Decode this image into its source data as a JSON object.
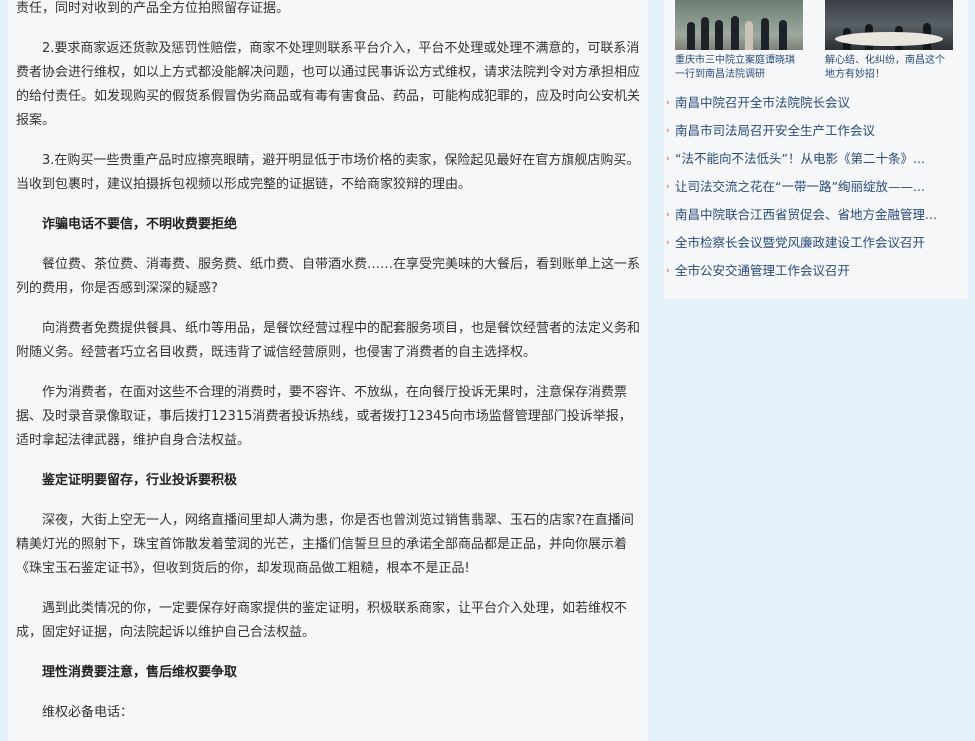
{
  "article": {
    "paragraphs": [
      {
        "kind": "text",
        "text": "责任，同时对收到的产品全方位拍照留存证据。"
      },
      {
        "kind": "text",
        "text": "2.要求商家返还货款及惩罚性赔偿，商家不处理则联系平台介入，平台不处理或处理不满意的，可联系消费者协会进行维权，如以上方式都没能解决问题，也可以通过民事诉讼方式维权，请求法院判令对方承担相应的给付责任。如发现购买的假货系假冒伪劣商品或有毒有害食品、药品，可能构成犯罪的，应及时向公安机关报案。"
      },
      {
        "kind": "text",
        "text": "3.在购买一些贵重产品时应擦亮眼睛，避开明显低于市场价格的卖家，保险起见最好在官方旗舰店购买。当收到包裹时，建议拍摄拆包视频以形成完整的证据链，不给商家狡辩的理由。"
      },
      {
        "kind": "heading",
        "text": "诈骗电话不要信，不明收费要拒绝"
      },
      {
        "kind": "text",
        "text": "餐位费、茶位费、消毒费、服务费、纸巾费、自带酒水费……在享受完美味的大餐后，看到账单上这一系列的费用，你是否感到深深的疑惑?"
      },
      {
        "kind": "text",
        "text": "向消费者免费提供餐具、纸巾等用品，是餐饮经营过程中的配套服务项目，也是餐饮经营者的法定义务和附随义务。经营者巧立名目收费，既违背了诚信经营原则，也侵害了消费者的自主选择权。"
      },
      {
        "kind": "text",
        "text": "作为消费者，在面对这些不合理的消费时，要不容许、不放纵，在向餐厅投诉无果时，注意保存消费票据、及时录音录像取证，事后拨打12315消费者投诉热线，或者拨打12345向市场监督管理部门投诉举报，适时拿起法律武器，维护自身合法权益。"
      },
      {
        "kind": "heading",
        "text": "鉴定证明要留存，行业投诉要积极"
      },
      {
        "kind": "text",
        "text": "深夜，大街上空无一人，网络直播间里却人满为患，你是否也曾浏览过销售翡翠、玉石的店家?在直播间精美灯光的照射下，珠宝首饰散发着莹润的光芒，主播们信誓旦旦的承诺全部商品都是正品，并向你展示着《珠宝玉石鉴定证书》，但收到货后的你，却发现商品做工粗糙，根本不是正品!"
      },
      {
        "kind": "text",
        "text": "遇到此类情况的你，一定要保存好商家提供的鉴定证明，积极联系商家，让平台介入处理，如若维权不成，固定好证据，向法院起诉以维护自己合法权益。"
      },
      {
        "kind": "heading",
        "text": "理性消费要注意，售后维权要争取"
      },
      {
        "kind": "text",
        "text": "维权必备电话："
      }
    ]
  },
  "sidebar": {
    "photos": [
      {
        "caption": "重庆市三中院立案庭谭晓琪一行到南昌法院调研"
      },
      {
        "caption": "解心结、化纠纷，南昌这个地方有妙招！"
      }
    ],
    "news": [
      {
        "title": "南昌中院召开全市法院院长会议"
      },
      {
        "title": "南昌市司法局召开安全生产工作会议"
      },
      {
        "title": "“法不能向不法低头”！从电影《第二十条》..."
      },
      {
        "title": "让司法交流之花在“一带一路”绚丽绽放——..."
      },
      {
        "title": "南昌中院联合江西省贸促会、省地方金融管理..."
      },
      {
        "title": "全市检察长会议暨党风廉政建设工作会议召开"
      },
      {
        "title": "全市公安交通管理工作会议召开"
      }
    ]
  },
  "colors": {
    "page_background": "#e3f3f9",
    "panel_background": "#f5f7f8",
    "body_text": "#333333",
    "link_text": "#2a4a7a",
    "bullet_arrow": "#e04b3a"
  },
  "icons": {
    "list_bullet": "red-arrow-bullet-icon"
  }
}
